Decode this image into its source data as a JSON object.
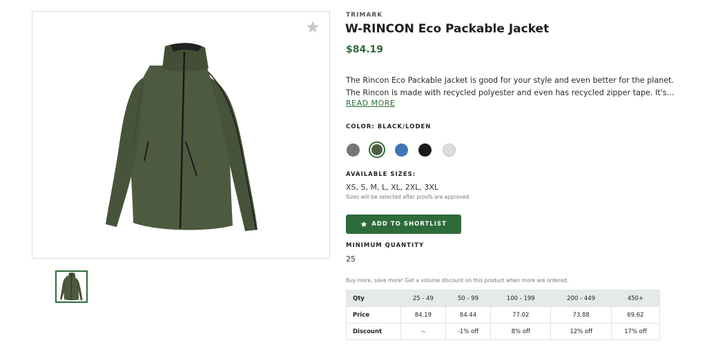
{
  "product": {
    "brand": "TRIMARK",
    "title": "W-RINCON Eco Packable Jacket",
    "price": "$84.19",
    "description_line1": "The Rincon Eco Packable Jacket is good for your style and even better for the planet.",
    "description_line2": "The Rincon is made with recycled polyester and even has recycled zipper tape. It's...",
    "read_more": "READ MORE"
  },
  "color": {
    "label": "COLOR: BLACK/LODEN",
    "swatches": [
      {
        "name": "grey",
        "hex": "#777777",
        "selected": false
      },
      {
        "name": "loden",
        "hex": "#4f5d42",
        "selected": true
      },
      {
        "name": "blue",
        "hex": "#3f76b6",
        "selected": false
      },
      {
        "name": "black",
        "hex": "#1a1a1a",
        "selected": false
      },
      {
        "name": "light-grey",
        "hex": "#dcdcdc",
        "selected": false
      }
    ]
  },
  "sizes": {
    "label": "AVAILABLE SIZES:",
    "list": "XS, S, M, L, XL, 2XL, 3XL",
    "note": "Sizes will be selected after proofs are approved"
  },
  "shortlist_button": {
    "label": "ADD TO SHORTLIST",
    "icon": "star-icon"
  },
  "minimum_quantity": {
    "label": "MINIMUM QUANTITY",
    "value": "25"
  },
  "volume_note": "Buy more, save more! Get a volume discount on this product when more are ordered.",
  "pricing_table": {
    "headers": [
      "Qty",
      "25 - 49",
      "50 - 99",
      "100 - 199",
      "200 - 449",
      "450+"
    ],
    "rows": [
      [
        "Price",
        "84.19",
        "84.44",
        "77.02",
        "73.88",
        "69.62"
      ],
      [
        "Discount",
        "--",
        "-1% off",
        "8% off",
        "12% off",
        "17% off"
      ]
    ]
  },
  "colors": {
    "accent": "#2e6b3a",
    "table_header_bg": "#e4ebe6"
  }
}
